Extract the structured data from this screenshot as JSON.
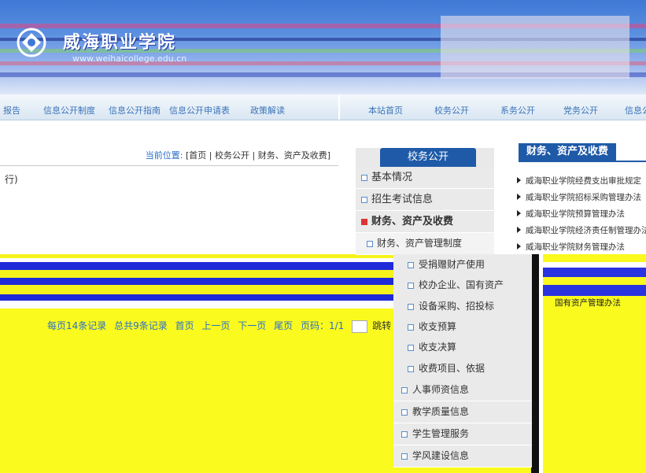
{
  "header": {
    "school_name": "威海职业学院",
    "url_text": "www.weihaicollege.edu.cn"
  },
  "nav": {
    "items": [
      "报告",
      "信息公开制度",
      "信息公开指南",
      "信息公开申请表",
      "政策解读",
      "本站首页",
      "校务公开",
      "系务公开",
      "党务公开",
      "信息公"
    ]
  },
  "breadcrumb": {
    "label": "当前位置:",
    "path": "[首页 | 校务公开 | 财务、资产及收费]"
  },
  "content": {
    "left_text": "行)"
  },
  "pager": {
    "per_page": "每页14条记录",
    "total": "总共9条记录",
    "first": "首页",
    "prev": "上一页",
    "next": "下一页",
    "last": "尾页",
    "page": "页码：1/1",
    "jump": "跳转"
  },
  "side_menu": {
    "title": "校务公开",
    "items": [
      {
        "label": "基本情况",
        "active": false
      },
      {
        "label": "招生考试信息",
        "active": false
      },
      {
        "label": "财务、资产及收费",
        "active": true
      }
    ],
    "sub_top": "财务、资产管理制度",
    "sub_items": [
      "受捐赠财产使用",
      "校办企业、国有资产",
      "设备采购、招投标",
      "收支预算",
      "收支决算",
      "收费项目、依据"
    ],
    "bottom_items": [
      "人事师资信息",
      "教学质量信息",
      "学生管理服务",
      "学风建设信息"
    ]
  },
  "article_list": {
    "title": "财务、资产及收费",
    "items": [
      "威海职业学院经费支出审批规定（",
      "威海职业学院招标采购管理办法",
      "威海职业学院预算管理办法",
      "威海职业学院经济责任制管理办法",
      "威海职业学院财务管理办法"
    ],
    "low_item": "国有资产管理办法"
  },
  "colors": {
    "accent": "#1f5aa8",
    "link": "#2a6fc9",
    "glitch_yellow": "#fafa1e",
    "glitch_blue": "#1f2ad8"
  }
}
